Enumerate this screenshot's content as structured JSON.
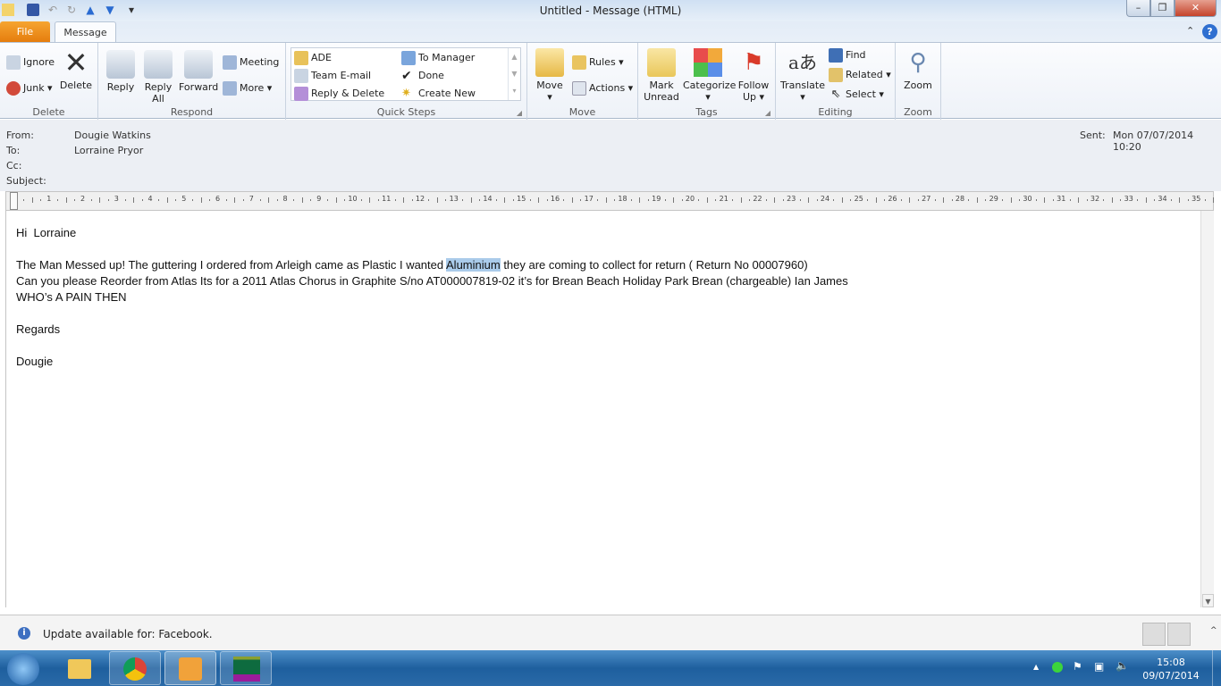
{
  "window": {
    "title": "Untitled  -  Message (HTML)"
  },
  "tabs": {
    "file": "File",
    "message": "Message"
  },
  "ribbon": {
    "delete": {
      "label": "Delete",
      "ignore": "Ignore",
      "junk": "Junk",
      "delete": "Delete"
    },
    "respond": {
      "label": "Respond",
      "reply": "Reply",
      "reply_all_1": "Reply",
      "reply_all_2": "All",
      "forward": "Forward",
      "meeting": "Meeting",
      "more": "More"
    },
    "quick_steps": {
      "label": "Quick Steps",
      "items": [
        "ADE",
        "To Manager",
        "Team E-mail",
        "Done",
        "Reply & Delete",
        "Create New"
      ]
    },
    "move": {
      "label": "Move",
      "move": "Move",
      "rules": "Rules",
      "actions": "Actions"
    },
    "tags": {
      "label": "Tags",
      "mark_unread_1": "Mark",
      "mark_unread_2": "Unread",
      "categorize": "Categorize",
      "follow_up_1": "Follow",
      "follow_up_2": "Up"
    },
    "editing": {
      "label": "Editing",
      "translate": "Translate",
      "find": "Find",
      "related": "Related",
      "select": "Select"
    },
    "zoom": {
      "label": "Zoom",
      "zoom": "Zoom"
    }
  },
  "header": {
    "from_label": "From:",
    "from": "Dougie Watkins",
    "to_label": "To:",
    "to": "Lorraine Pryor",
    "cc_label": "Cc:",
    "cc": "",
    "subject_label": "Subject:",
    "subject": "",
    "sent_label": "Sent:",
    "sent": "Mon 07/07/2014 10:20"
  },
  "ruler_labels": [
    "1",
    "2",
    "3",
    "4",
    "5",
    "6",
    "7",
    "8",
    "9",
    "10",
    "11",
    "12",
    "13",
    "14",
    "15",
    "16",
    "17",
    "18",
    "19",
    "20",
    "21",
    "22",
    "23",
    "24",
    "25",
    "26",
    "27",
    "28",
    "29",
    "30",
    "31",
    "32",
    "33",
    "34",
    "35"
  ],
  "body": {
    "greeting": "Hi  Lorraine",
    "line1_a": "The Man Messed up! The guttering I ordered from Arleigh came as Plastic I wanted ",
    "line1_sel": "Aluminium",
    "line1_b": " they are coming to collect for return ( Return No 00007960)",
    "line2": "Can you please Reorder from Atlas Its for a 2011 Atlas Chorus in Graphite S/no AT000007819-02 it’s for Brean Beach Holiday Park Brean (chargeable) Ian James",
    "line3": "WHO’s A PAIN THEN",
    "regards": "Regards",
    "signature": "Dougie"
  },
  "info_bar": {
    "text": "Update available for: Facebook."
  },
  "taskbar": {
    "time": "15:08",
    "date": "09/07/2014"
  }
}
